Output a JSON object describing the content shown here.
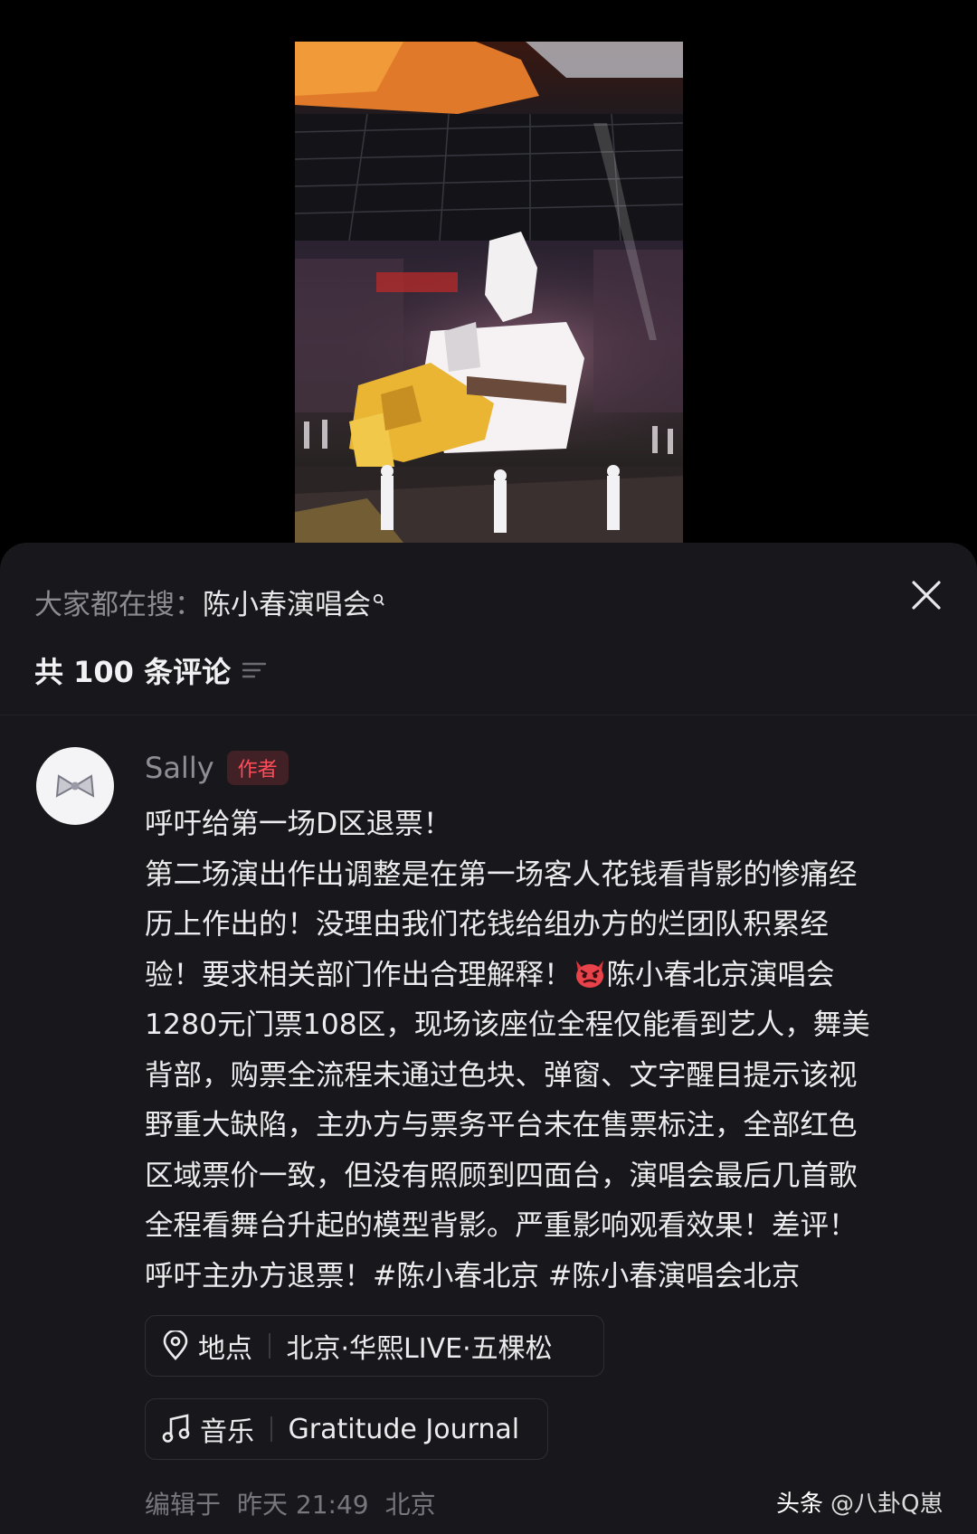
{
  "search": {
    "prefix": "大家都在搜：",
    "keyword": "陈小春演唱会"
  },
  "comments_header": {
    "count_label": "共 100 条评论"
  },
  "post": {
    "author": "Sally",
    "author_badge": "作者",
    "lines": [
      "呼吁给第一场D区退票！",
      "第二场演出作出调整是在第一场客人花钱看背影的惨痛经",
      "历上作出的！没理由我们花钱给组办方的烂团队积累经",
      "1280元门票108区，现场该座位全程仅能看到艺人，舞美",
      "背部，购票全流程未通过色块、弹窗、文字醒目提示该视",
      "野重大缺陷，主办方与票务平台未在售票标注，全部红色",
      "区域票价一致，但没有照顾到四面台，演唱会最后几首歌",
      "全程看舞台升起的模型背影。严重影响观看效果！差评！",
      "呼吁主办方退票！#陈小春北京 #陈小春演唱会北京"
    ],
    "line_emoji_before": "验！要求相关部门作出合理解释！",
    "line_emoji_after": "陈小春北京演唱会",
    "location": {
      "label": "地点",
      "value": "北京·华熙LIVE·五棵松"
    },
    "music": {
      "label": "音乐",
      "value": "Gratitude Journal"
    },
    "meta": {
      "edited": "编辑于",
      "time": "昨天 21:49",
      "place": "北京"
    }
  },
  "watermark": {
    "brand": "头条",
    "handle": "@八卦Q崽"
  },
  "icons": {
    "close": "close-icon",
    "sort": "sort-icon",
    "location": "location-pin-icon",
    "music": "music-note-icon",
    "emoji": "angry-devil-emoji"
  },
  "colors": {
    "sheet_bg": "#18181c",
    "badge": "#ff4d5a",
    "muted": "#8e8e94"
  }
}
